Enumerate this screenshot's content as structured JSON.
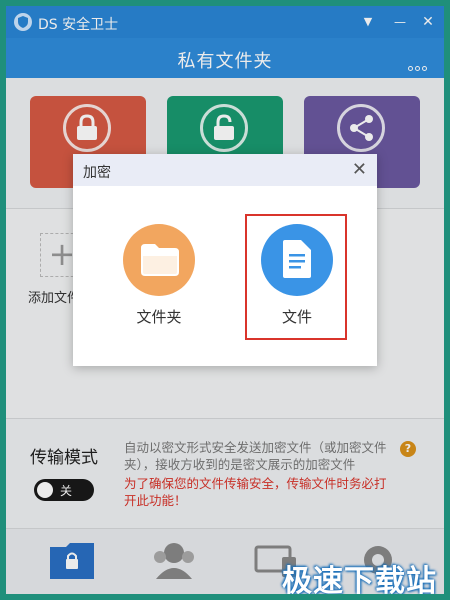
{
  "window": {
    "title": "DS 安全卫士",
    "minimize_glyph": "▼",
    "close_glyph": "✕"
  },
  "header": {
    "title": "私有文件夹",
    "more_icon": "more-dots-icon"
  },
  "cards": [
    {
      "color": "#d65a44",
      "icon": "lock-icon"
    },
    {
      "color": "#1a9a70",
      "icon": "unlock-icon"
    },
    {
      "color": "#6b58a0",
      "icon": "share-icon"
    }
  ],
  "add": {
    "plus": "+",
    "label": "添加文件"
  },
  "transfer": {
    "title": "传输模式",
    "toggle_label": "关",
    "description": "自动以密文形式安全发送加密文件（或加密文件夹），接收方收到的是密文展示的加密文件",
    "warning": "为了确保您的文件传输安全，传输文件时务必打开此功能！",
    "help": "?"
  },
  "dialog": {
    "title": "加密",
    "close": "✕",
    "options": [
      {
        "label": "文件夹",
        "color": "#f2a65f",
        "icon": "folder-icon"
      },
      {
        "label": "文件",
        "color": "#3a94e6",
        "icon": "document-icon",
        "selected": true
      }
    ]
  },
  "bottom_nav": [
    {
      "icon": "lock-folder-icon",
      "active": true
    },
    {
      "icon": "users-icon"
    },
    {
      "icon": "devices-icon"
    },
    {
      "icon": "settings-icon"
    }
  ],
  "watermark": "极速下载站",
  "colors": {
    "accent": "#2a86d6",
    "warning": "#d9342b",
    "selected_border": "#d9342b"
  }
}
